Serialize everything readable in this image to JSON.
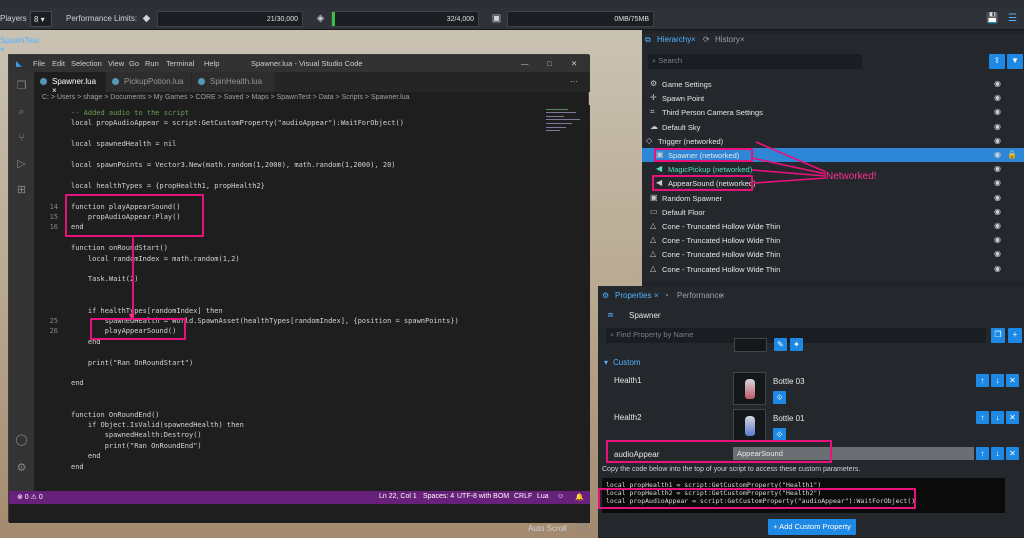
{
  "toolbar": {
    "players_label": "Players",
    "players_value": "8",
    "perf_label": "Performance Limits:",
    "field1": "21/30,000",
    "field2": "32/4,000",
    "field3": "0MB/75MB"
  },
  "viewport": {
    "tab": "SpawnTest"
  },
  "vscode": {
    "menu": [
      "File",
      "Edit",
      "Selection",
      "View",
      "Go",
      "Run",
      "Terminal",
      "Help"
    ],
    "title": "Spawner.lua - Visual Studio Code",
    "tabs": [
      "Spawner.lua",
      "PickupPotion.lua",
      "SpinHealth.lua"
    ],
    "breadcrumb": "C: > Users > shage > Documents > My Games > CORE > Saved > Maps > SpawnTest > Data > Scripts > Spawner.lua",
    "status_left": "⊗ 0 ⚠ 0",
    "status_ln": "Ln 22, Col 1",
    "status_spaces": "Spaces: 4",
    "status_enc": "UTF-8 with BOM",
    "status_crlf": "CRLF",
    "status_lang": "Lua",
    "code": [
      {
        "n": "",
        "t": "-- Added audio to the script",
        "c": "cm"
      },
      {
        "n": "",
        "t": "local propAudioAppear = script:GetCustomProperty(\"audioAppear\"):WaitForObject()",
        "c": ""
      },
      {
        "n": "",
        "t": "",
        "c": ""
      },
      {
        "n": "",
        "t": "local spawnedHealth = nil",
        "c": ""
      },
      {
        "n": "",
        "t": "",
        "c": ""
      },
      {
        "n": "",
        "t": "local spawnPoints = Vector3.New(math.random(1,2000), math.random(1,2000), 20)",
        "c": ""
      },
      {
        "n": "",
        "t": "",
        "c": ""
      },
      {
        "n": "",
        "t": "local healthTypes = {propHealth1, propHealth2}",
        "c": ""
      },
      {
        "n": "",
        "t": "",
        "c": ""
      },
      {
        "n": "14",
        "t": "function playAppearSound()",
        "c": ""
      },
      {
        "n": "15",
        "t": "    propAudioAppear:Play()",
        "c": ""
      },
      {
        "n": "16",
        "t": "end",
        "c": ""
      },
      {
        "n": "",
        "t": "",
        "c": ""
      },
      {
        "n": "",
        "t": "function onRoundStart()",
        "c": ""
      },
      {
        "n": "",
        "t": "    local randomIndex = math.random(1,2)",
        "c": ""
      },
      {
        "n": "",
        "t": "",
        "c": ""
      },
      {
        "n": "",
        "t": "    Task.Wait(2)",
        "c": ""
      },
      {
        "n": "",
        "t": "",
        "c": ""
      },
      {
        "n": "",
        "t": "",
        "c": ""
      },
      {
        "n": "",
        "t": "    if healthTypes[randomIndex] then",
        "c": ""
      },
      {
        "n": "25",
        "t": "        spawnedHealth = World.SpawnAsset(healthTypes[randomIndex], {position = spawnPoints})",
        "c": ""
      },
      {
        "n": "26",
        "t": "        playAppearSound()",
        "c": ""
      },
      {
        "n": "",
        "t": "    end",
        "c": ""
      },
      {
        "n": "",
        "t": "",
        "c": ""
      },
      {
        "n": "",
        "t": "    print(\"Ran OnRoundStart\")",
        "c": ""
      },
      {
        "n": "",
        "t": "",
        "c": ""
      },
      {
        "n": "",
        "t": "end",
        "c": ""
      },
      {
        "n": "",
        "t": "",
        "c": ""
      },
      {
        "n": "",
        "t": "",
        "c": ""
      },
      {
        "n": "",
        "t": "function OnRoundEnd()",
        "c": ""
      },
      {
        "n": "",
        "t": "    if Object.IsValid(spawnedHealth) then",
        "c": ""
      },
      {
        "n": "",
        "t": "        spawnedHealth:Destroy()",
        "c": ""
      },
      {
        "n": "",
        "t": "        print(\"Ran OnRoundEnd\")",
        "c": ""
      },
      {
        "n": "",
        "t": "    end",
        "c": ""
      },
      {
        "n": "",
        "t": "end",
        "c": ""
      }
    ]
  },
  "auto_scroll": "Auto Scroll",
  "hierarchy": {
    "tab": "Hierarchy",
    "tab2": "History",
    "search_placeholder": "Search",
    "items": [
      "Game Settings",
      "Spawn Point",
      "Third Person Camera Settings",
      "Default Sky",
      "Trigger (networked)",
      "Spawner (networked)",
      "MagicPickup (networked)",
      "AppearSound (networked)",
      "Random Spawner",
      "Default Floor",
      "Cone - Truncated Hollow Wide Thin",
      "Cone - Truncated Hollow Wide Thin",
      "Cone - Truncated Hollow Wide Thin",
      "Cone - Truncated Hollow Wide Thin"
    ],
    "annotation": "Networked!"
  },
  "properties": {
    "tab": "Properties",
    "tab2": "Performance",
    "name": "Spawner",
    "find_placeholder": "Find Property by Name",
    "section": "Custom",
    "health1_label": "Health1",
    "health1_value": "Bottle 03",
    "health2_label": "Health2",
    "health2_value": "Bottle 01",
    "audio_label": "audioAppear",
    "audio_value": "AppearSound",
    "copy_hint": "Copy the code below into the top of your script to access these custom parameters.",
    "code1": "local propHealth1 = script:GetCustomProperty(\"Health1\")",
    "code2": "local propHealth2 = script:GetCustomProperty(\"Health2\")",
    "code3": "local propAudioAppear = script:GetCustomProperty(\"audioAppear\"):WaitForObject()",
    "add_button": "Add Custom Property"
  }
}
